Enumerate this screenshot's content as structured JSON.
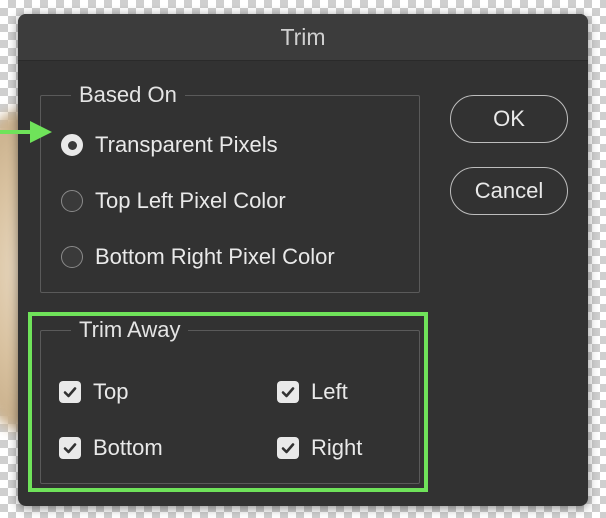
{
  "dialog": {
    "title": "Trim"
  },
  "based_on": {
    "legend": "Based On",
    "options": [
      {
        "label": "Transparent Pixels",
        "selected": true
      },
      {
        "label": "Top Left Pixel Color",
        "selected": false
      },
      {
        "label": "Bottom Right Pixel Color",
        "selected": false
      }
    ]
  },
  "trim_away": {
    "legend": "Trim Away",
    "options": [
      {
        "label": "Top",
        "checked": true
      },
      {
        "label": "Left",
        "checked": true
      },
      {
        "label": "Bottom",
        "checked": true
      },
      {
        "label": "Right",
        "checked": true
      }
    ]
  },
  "buttons": {
    "ok": "OK",
    "cancel": "Cancel"
  },
  "colors": {
    "highlight": "#6fe35a",
    "dialog_bg": "#323232"
  },
  "icons": {
    "pointer": "arrow-right-icon",
    "check": "checkmark-icon"
  }
}
